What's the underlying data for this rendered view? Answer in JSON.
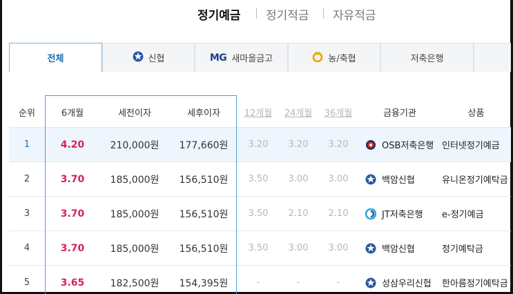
{
  "top_tabs": [
    {
      "label": "정기예금",
      "active": true
    },
    {
      "label": "정기적금",
      "active": false
    },
    {
      "label": "자유적금",
      "active": false
    }
  ],
  "institution_tabs": [
    {
      "label": "전체",
      "active": true,
      "icon": ""
    },
    {
      "label": "신협",
      "active": false,
      "icon": "shinhyup-logo-icon"
    },
    {
      "label": "새마을금고",
      "active": false,
      "icon": "mg-logo-icon",
      "mark": "MG"
    },
    {
      "label": "농/축협",
      "active": false,
      "icon": "nonghyup-logo-icon"
    },
    {
      "label": "저축은행",
      "active": false,
      "icon": ""
    }
  ],
  "table": {
    "headers": {
      "rank": "순위",
      "m6": "6개월",
      "pretax": "세전이자",
      "aftertax": "세후이자",
      "m12": "12개월",
      "m24": "24개월",
      "m36": "36개월",
      "institution": "금융기관",
      "product": "상품"
    },
    "rows": [
      {
        "rank": "1",
        "m6": "4.20",
        "pretax": "210,000원",
        "aftertax": "177,660원",
        "m12": "3.20",
        "m24": "3.20",
        "m36": "3.20",
        "institution": "OSB저축은행",
        "inst_icon": "osb-logo-icon",
        "product": "인터넷정기예금",
        "highlight": true
      },
      {
        "rank": "2",
        "m6": "3.70",
        "pretax": "185,000원",
        "aftertax": "156,510원",
        "m12": "3.50",
        "m24": "3.00",
        "m36": "3.00",
        "institution": "백암신협",
        "inst_icon": "shinhyup-logo-icon",
        "product": "유니온정기예탁금",
        "highlight": false
      },
      {
        "rank": "3",
        "m6": "3.70",
        "pretax": "185,000원",
        "aftertax": "156,510원",
        "m12": "3.50",
        "m24": "2.10",
        "m36": "2.10",
        "institution": "JT저축은행",
        "inst_icon": "jt-logo-icon",
        "product": "e-정기예금",
        "highlight": false
      },
      {
        "rank": "4",
        "m6": "3.70",
        "pretax": "185,000원",
        "aftertax": "156,510원",
        "m12": "3.50",
        "m24": "3.00",
        "m36": "3.00",
        "institution": "백암신협",
        "inst_icon": "shinhyup-logo-icon",
        "product": "정기예탁금",
        "highlight": false
      },
      {
        "rank": "5",
        "m6": "3.65",
        "pretax": "182,500원",
        "aftertax": "154,395원",
        "m12": "-",
        "m24": "-",
        "m36": "-",
        "institution": "성삼우리신협",
        "inst_icon": "shinhyup-logo-icon",
        "product": "한아름정기예탁금",
        "highlight": false
      }
    ]
  },
  "colors": {
    "accent": "#1a6db3",
    "rate": "#d6215b",
    "highlight_row": "#eef5fd",
    "focus_border": "#4f9be0"
  }
}
